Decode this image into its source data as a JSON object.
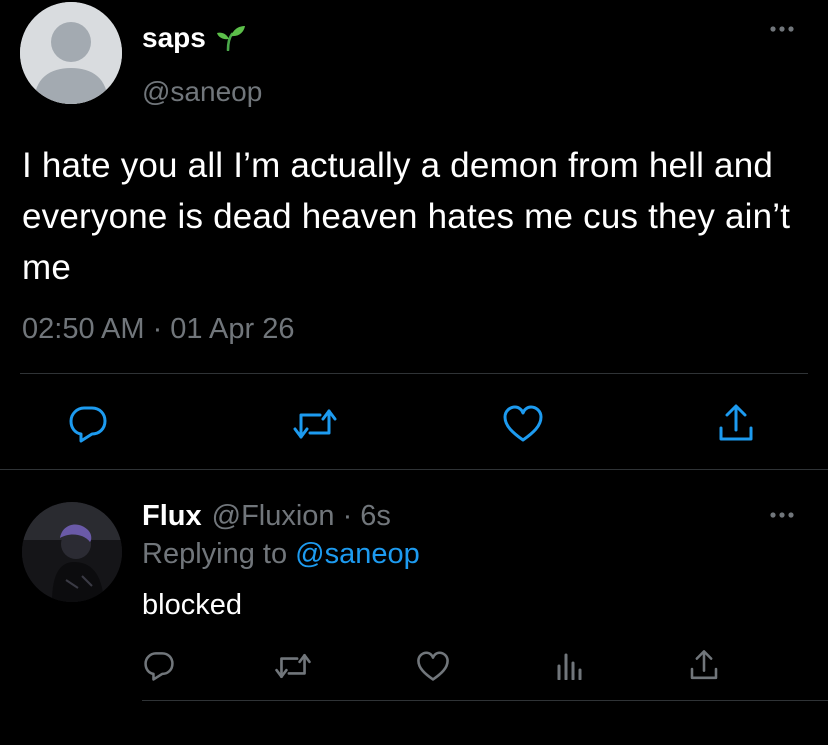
{
  "tweet": {
    "author_name": "saps",
    "author_handle": "@saneop",
    "name_emoji_icon": "seedling-icon",
    "text": "I hate you all I’m actually a demon from hell and everyone is dead heaven hates me cus they ain’t me",
    "timestamp": "02:50 AM · 01 Apr 26",
    "actions": [
      "reply-icon",
      "retweet-icon",
      "like-icon",
      "share-icon"
    ]
  },
  "reply": {
    "author_name": "Flux",
    "author_handle": "@Fluxion",
    "separator": "·",
    "time_ago": "6s",
    "replying_prefix": "Replying to",
    "replying_to": "@saneop",
    "text": "blocked",
    "actions": [
      "reply-icon",
      "retweet-icon",
      "like-icon",
      "analytics-icon",
      "share-icon"
    ]
  },
  "colors": {
    "background": "#000000",
    "text": "#e7e9ea",
    "muted": "#71767b",
    "link": "#1d9bf0",
    "divider": "#2f3336"
  }
}
